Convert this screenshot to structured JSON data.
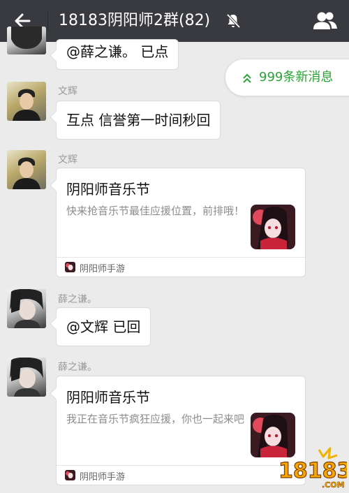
{
  "header": {
    "title": "18183阴阳师2群(82)",
    "back_icon": "back-arrow-icon",
    "mute_icon": "mute-bell-icon",
    "members_icon": "group-members-icon"
  },
  "new_messages": {
    "label": "999条新消息",
    "icon": "double-chevron-up-icon",
    "color": "#2aa336"
  },
  "messages": [
    {
      "type": "text",
      "sender": "",
      "text": "@薛之谦。 已点"
    },
    {
      "type": "text",
      "sender": "文辉",
      "text": "互点 信誉第一时间秒回"
    },
    {
      "type": "card",
      "sender": "文辉",
      "title": "阴阳师音乐节",
      "description": "快来抢音乐节最佳应援位置，前排哦！",
      "source": "阴阳师手游"
    },
    {
      "type": "text",
      "sender": "薛之谦。",
      "text": "@文辉 已回"
    },
    {
      "type": "card",
      "sender": "薛之谦。",
      "title": "阴阳师音乐节",
      "description": "我正在音乐节疯狂应援，你也一起来吧",
      "source": "阴阳师手游"
    }
  ],
  "watermark": {
    "text": "18183",
    "suffix": ".COM"
  },
  "colors": {
    "topbar": "#393a3f",
    "background": "#ebebeb",
    "accent_green": "#2aa336",
    "name_gray": "#9a9a9a"
  }
}
